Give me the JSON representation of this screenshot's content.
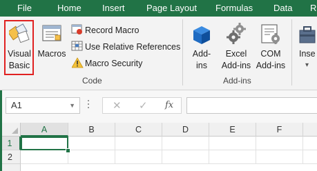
{
  "menu": {
    "tabs": [
      {
        "label": "File"
      },
      {
        "label": "Home"
      },
      {
        "label": "Insert"
      },
      {
        "label": "Page Layout"
      },
      {
        "label": "Formulas"
      },
      {
        "label": "Data"
      },
      {
        "label": "R"
      }
    ]
  },
  "ribbon": {
    "code_group": {
      "visual_basic_line1": "Visual",
      "visual_basic_line2": "Basic",
      "macros_label": "Macros",
      "record_macro": "Record Macro",
      "use_relative_references": "Use Relative References",
      "macro_security": "Macro Security",
      "group_label": "Code"
    },
    "addins_group": {
      "addins_line1": "Add-",
      "addins_line2": "ins",
      "excel_addins_line1": "Excel",
      "excel_addins_line2": "Add-ins",
      "com_addins_line1": "COM",
      "com_addins_line2": "Add-ins",
      "group_label": "Add-ins"
    },
    "insert_group": {
      "insert_label": "Inse",
      "dropdown_arrow": "▾"
    }
  },
  "formula_bar": {
    "name_box_value": "A1",
    "cancel_symbol": "✕",
    "enter_symbol": "✓",
    "fx_symbol": "fx",
    "formula_value": ""
  },
  "sheet": {
    "columns": [
      "A",
      "B",
      "C",
      "D",
      "E",
      "F"
    ],
    "rows": [
      "1",
      "2"
    ],
    "active_cell": "A1"
  },
  "colors": {
    "excel_green": "#217346",
    "highlight_red": "#e02020"
  }
}
